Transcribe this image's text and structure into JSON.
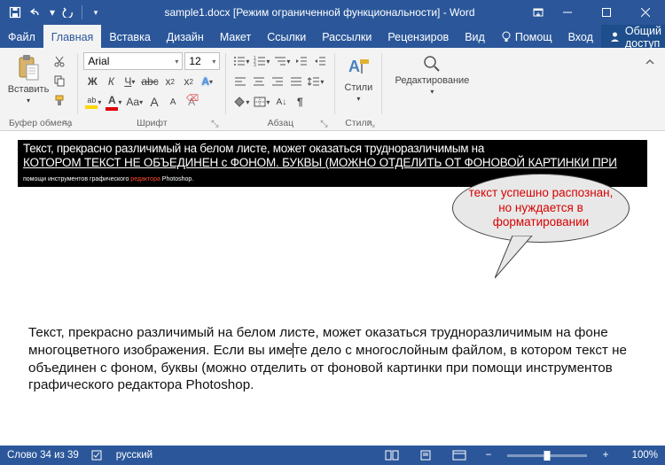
{
  "title": "sample1.docx [Режим ограниченной функциональности] - Word",
  "tabs": {
    "file": "Файл",
    "home": "Главная",
    "insert": "Вставка",
    "design": "Дизайн",
    "layout": "Макет",
    "references": "Ссылки",
    "mailings": "Рассылки",
    "review": "Рецензиров",
    "view": "Вид",
    "tell": "Помощ",
    "signin": "Вход",
    "share": "Общий доступ"
  },
  "ribbon": {
    "paste": "Вставить",
    "clipboard_label": "Буфер обмена",
    "font_label": "Шрифт",
    "paragraph_label": "Абзац",
    "styles": "Стили",
    "styles_label": "Стили",
    "editing": "Редактирование",
    "font_name": "Arial",
    "font_size": "12",
    "bold": "Ж",
    "italic": "К",
    "underline": "Ч",
    "aa_upper": "Aa",
    "a_grow": "A",
    "a_shrink": "A"
  },
  "document": {
    "garbled_line1": "Текст, прекрасно различимый на белом листе, может оказаться трудноразличимым на",
    "garbled_line2": "КОТОРОМ ТЕКСТ НЕ ОБЪЕДИНЕН с ФОНОМ. БУКВЫ (МОЖНО ОТДЕЛИТЬ ОТ ФОНОВОЙ КАРТИНКИ ПРИ",
    "garbled_red": "редактора",
    "garbled_tail": " Photoshop.",
    "callout": "текст успешно распознан, но нуждается в форматировании",
    "para": "Текст, прекрасно различимый на белом листе, может оказаться трудноразличимым на фоне многоцветного изображения. Если вы име",
    "para2": "те дело с многослойным файлом, в котором текст не объединен с фоном, буквы (можно отделить от фоновой картинки при помощи инструментов графического редактора Photoshop."
  },
  "status": {
    "words": "Слово 34 из 39",
    "lang": "русский",
    "zoom": "100%"
  }
}
